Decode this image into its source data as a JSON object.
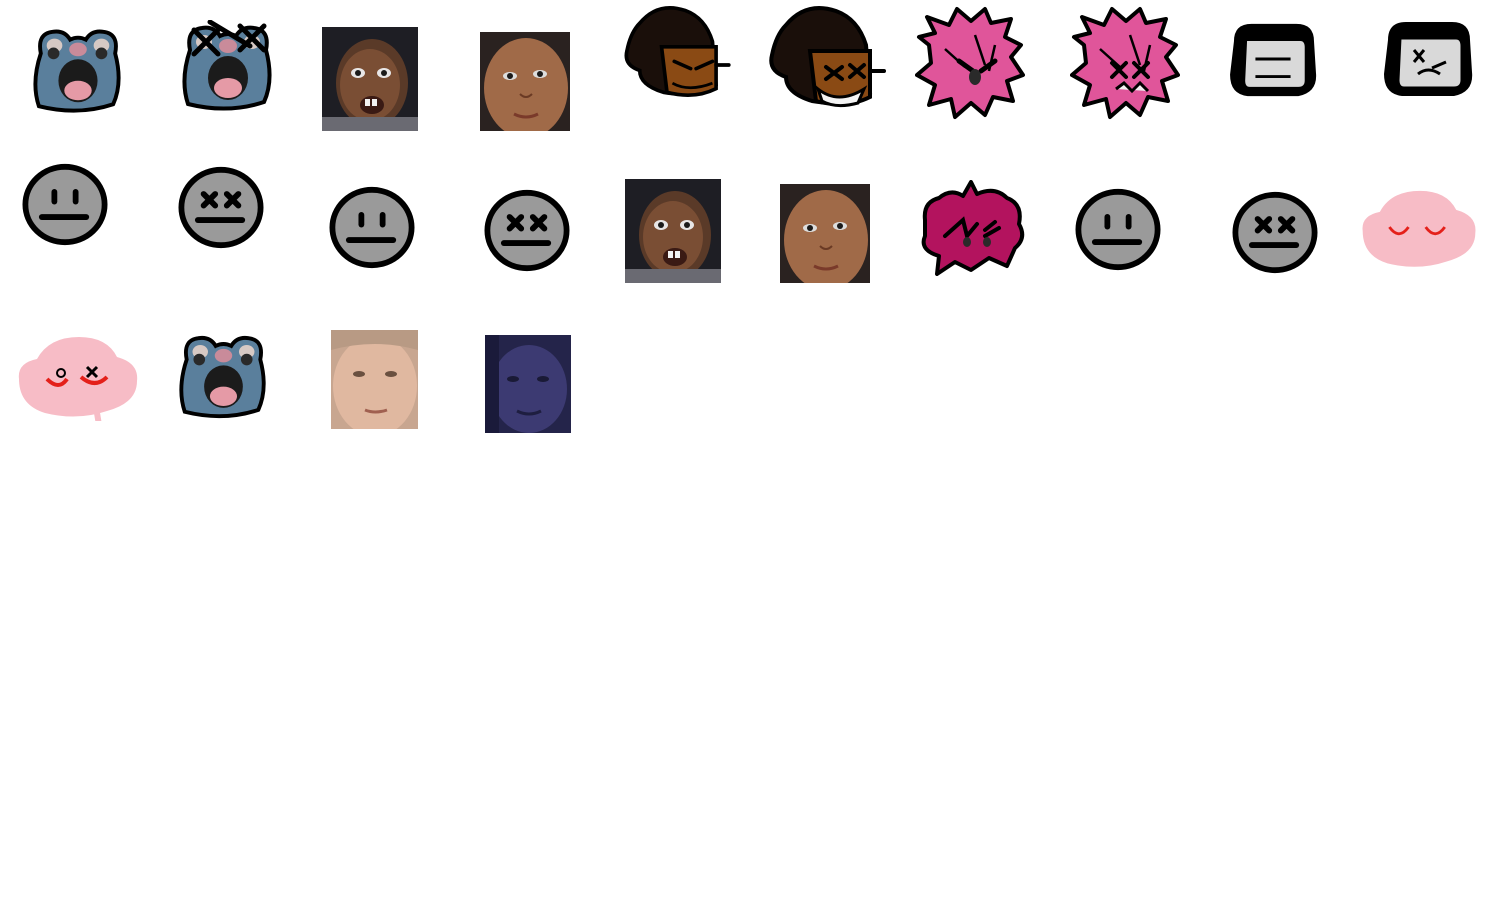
{
  "sheet": {
    "background": "#ffffff",
    "rows": [
      {
        "icons": [
          {
            "name": "blue-plush-icon",
            "state": "normal"
          },
          {
            "name": "blue-plush-icon",
            "state": "dead"
          },
          {
            "name": "girl-photo-1-icon",
            "state": "normal"
          },
          {
            "name": "girl-photo-2-icon",
            "state": "normal"
          },
          {
            "name": "brown-hair-character-icon",
            "state": "normal"
          },
          {
            "name": "brown-hair-character-icon",
            "state": "dead"
          },
          {
            "name": "pink-hair-character-icon",
            "state": "normal"
          },
          {
            "name": "pink-hair-character-icon",
            "state": "dead"
          },
          {
            "name": "black-hair-character-icon",
            "state": "normal"
          },
          {
            "name": "black-hair-character-icon",
            "state": "dead"
          }
        ]
      },
      {
        "icons": [
          {
            "name": "gray-face-icon",
            "state": "normal"
          },
          {
            "name": "gray-face-icon",
            "state": "dead"
          },
          {
            "name": "gray-face-icon",
            "state": "normal"
          },
          {
            "name": "gray-face-icon",
            "state": "dead"
          },
          {
            "name": "girl-photo-1-icon",
            "state": "normal"
          },
          {
            "name": "girl-photo-2-icon",
            "state": "normal"
          },
          {
            "name": "magenta-hair-character-icon",
            "state": "normal"
          },
          {
            "name": "gray-face-icon",
            "state": "normal"
          },
          {
            "name": "gray-face-icon",
            "state": "dead"
          },
          {
            "name": "pink-blob-icon",
            "state": "normal"
          }
        ]
      },
      {
        "icons": [
          {
            "name": "pink-blob-icon",
            "state": "dead"
          },
          {
            "name": "blue-plush-icon",
            "state": "normal"
          },
          {
            "name": "boy-photo-icon",
            "state": "normal"
          },
          {
            "name": "boy-photo-dark-icon",
            "state": "normal"
          }
        ]
      }
    ]
  },
  "colors": {
    "outline": "#000000",
    "gray_face": "#9a9a9a",
    "plush_blue": "#5a7f9c",
    "plush_mouth": "#e59aa6",
    "pink_hair": "#e0559a",
    "magenta_hair": "#b3135e",
    "brown_hair": "#1a0f0a",
    "brown_skin": "#8a4a14",
    "blob_pink": "#f7bcc6",
    "blob_red": "#e4201a",
    "black_hair_skin": "#d9d9d9"
  }
}
